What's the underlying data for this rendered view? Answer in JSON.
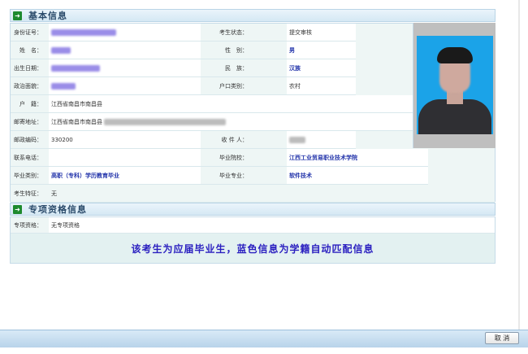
{
  "sections": {
    "basic_title": "基本信息",
    "special_title": "专项资格信息"
  },
  "basic": {
    "id_label": "身份证号：",
    "status_label": "考生状态：",
    "status_value": "提交审核",
    "name_label": "姓　名：",
    "gender_label": "性　别：",
    "gender_value": "男",
    "birth_label": "出生日期：",
    "ethnic_label": "民　族：",
    "ethnic_value": "汉族",
    "politics_label": "政治面貌：",
    "hukou_type_label": "户口类别：",
    "hukou_type_value": "农村",
    "hukou_label": "户　籍：",
    "hukou_value": "江西省南昌市南昌县",
    "address_label": "邮寄地址：",
    "address_value": "江西省南昌市南昌县",
    "postcode_label": "邮政编码：",
    "postcode_value": "330200",
    "recipient_label": "收 件 人：",
    "phone_label": "联系电话：",
    "school_label": "毕业院校：",
    "school_value": "江西工业贸易职业技术学院",
    "grad_type_label": "毕业类别：",
    "grad_type_value": "高职（专科）学历教育毕业",
    "major_label": "毕业专业：",
    "major_value": "软件技术",
    "feature_label": "考生特征：",
    "feature_value": "无"
  },
  "special": {
    "qual_label": "专项资格：",
    "qual_value": "无专项资格",
    "notice": "该考生为应届毕业生，蓝色信息为学籍自动匹配信息"
  },
  "footer": {
    "cancel_label": "取 消"
  },
  "colors": {
    "label_bg": "#eef6f5",
    "matched_text": "#2233aa",
    "notice_text": "#2a1fc0",
    "footer_bar": "#c8dff1"
  }
}
